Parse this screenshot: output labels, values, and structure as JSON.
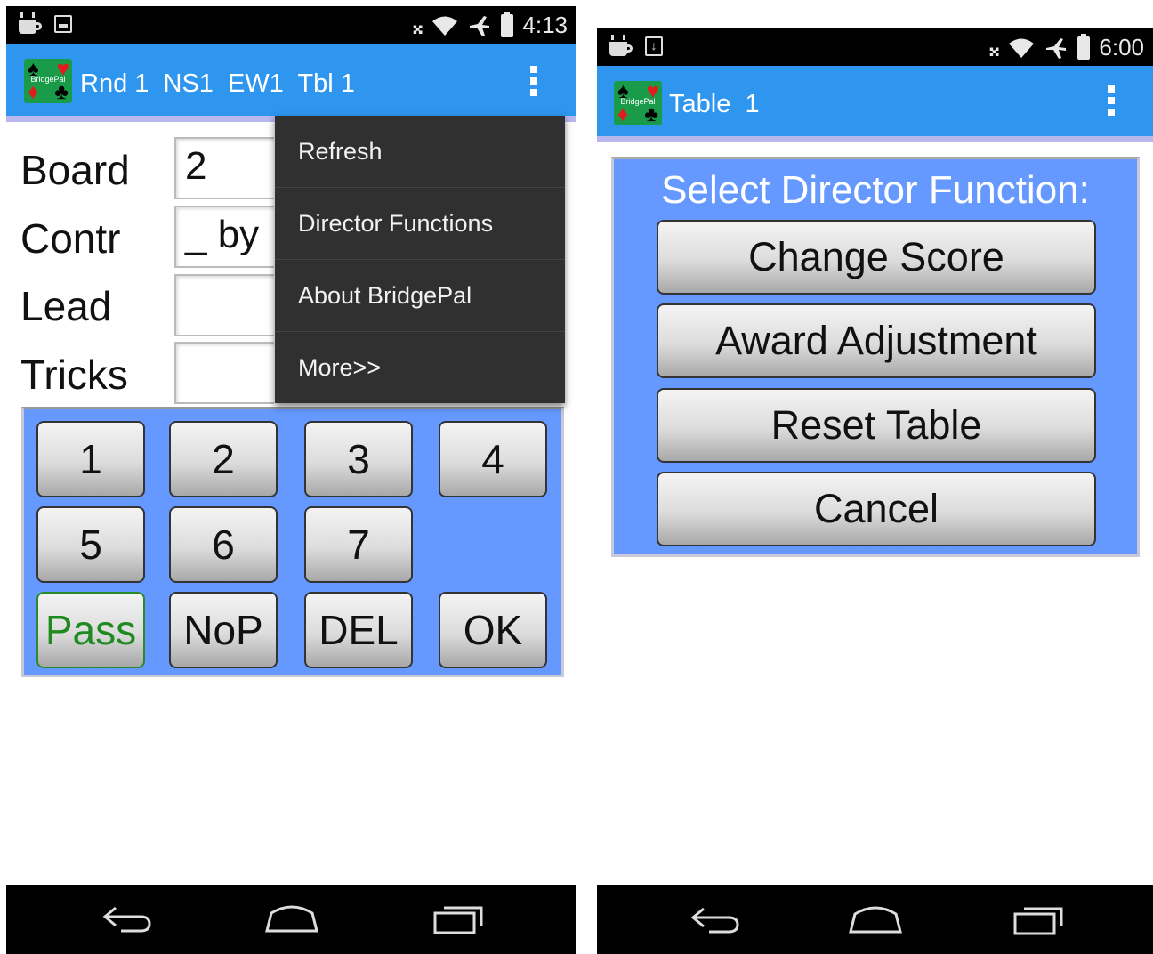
{
  "left_screen": {
    "status": {
      "time": "4:13"
    },
    "actionbar": {
      "title": "Rnd 1  NS1  EW1  Tbl 1",
      "logo_text": "BridgePal"
    },
    "form": {
      "board_label": "Board",
      "board_value": "2",
      "contract_label": "Contr",
      "contract_value": "_ by",
      "lead_label": "Lead",
      "lead_value": "",
      "tricks_label": "Tricks",
      "tricks_value": ""
    },
    "keypad": {
      "k1": "1",
      "k2": "2",
      "k3": "3",
      "k4": "4",
      "k5": "5",
      "k6": "6",
      "k7": "7",
      "pass": "Pass",
      "nop": "NoP",
      "del": "DEL",
      "ok": "OK"
    },
    "menu": {
      "refresh": "Refresh",
      "director": "Director Functions",
      "about": "About BridgePal",
      "more": "More>>"
    }
  },
  "right_screen": {
    "status": {
      "time": "6:00"
    },
    "actionbar": {
      "title": "Table  1",
      "logo_text": "BridgePal"
    },
    "dialog": {
      "title": "Select Director Function:",
      "change_score": "Change Score",
      "award_adjustment": "Award Adjustment",
      "reset_table": "Reset Table",
      "cancel": "Cancel"
    }
  },
  "colors": {
    "actionbar": "#2e96ef",
    "panel": "#6699ff",
    "logo_bg": "#1a9b4a",
    "pass_text": "#1f8a1f"
  }
}
